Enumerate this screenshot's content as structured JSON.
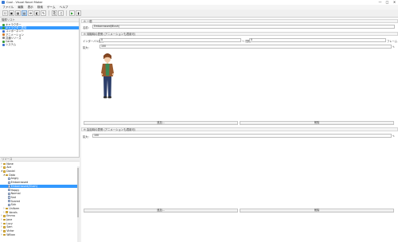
{
  "window": {
    "title": "Cool - Visual Novel Maker",
    "minimize": "—",
    "maximize": "□",
    "close": "✕"
  },
  "menu": [
    "ファイル",
    "編集",
    "表示",
    "検索",
    "ゲーム",
    "ヘルプ"
  ],
  "toolbar": {
    "icons": [
      "☐",
      "▣",
      "▦",
      "▤",
      "⛯",
      "◧",
      "✎",
      "⎘",
      "♫",
      "▶",
      "▮"
    ]
  },
  "left_panel": {
    "header": "階層リスト",
    "items": [
      {
        "label": "キャラクター",
        "color": "#3a9a3a"
      },
      {
        "label": "キャラクター表情",
        "color": "#3a9a3a",
        "selected": true
      },
      {
        "label": "コンポーネント",
        "color": "#3a6fd0"
      },
      {
        "label": "アニメーション",
        "color": "#d07a2a"
      },
      {
        "label": "共通リソース",
        "color": "#888888"
      },
      {
        "label": "Cards",
        "color": "#3a9a3a"
      },
      {
        "label": "システム",
        "color": "#3a6fd0"
      }
    ]
  },
  "lower_tree": {
    "header": "リソース",
    "rows": [
      {
        "label": "None",
        "level": 1,
        "type": "folder",
        "exp": "▷"
      },
      {
        "label": "Ace",
        "level": 1,
        "type": "folder",
        "exp": "▷"
      },
      {
        "label": "Daniel",
        "level": 1,
        "type": "folder",
        "exp": "◢"
      },
      {
        "label": "Data",
        "level": 2,
        "type": "folder",
        "exp": "◢"
      },
      {
        "label": "Angry",
        "level": 3,
        "type": "file"
      },
      {
        "label": "Embarrassed",
        "level": 3,
        "type": "file"
      },
      {
        "label": "Embarrassed(Blush)",
        "level": 3,
        "type": "file",
        "selected": true
      },
      {
        "label": "Happy",
        "level": 3,
        "type": "file"
      },
      {
        "label": "Normal",
        "level": 3,
        "type": "file"
      },
      {
        "label": "Sad",
        "level": 3,
        "type": "file"
      },
      {
        "label": "Scared",
        "level": 3,
        "type": "file"
      },
      {
        "label": "Sick",
        "level": 3,
        "type": "file"
      },
      {
        "label": "Uniform",
        "level": 2,
        "type": "folder",
        "exp": "▷"
      },
      {
        "label": "Vocals",
        "level": 2,
        "type": "folder",
        "exp": "▷"
      },
      {
        "label": "Emma",
        "level": 1,
        "type": "folder",
        "exp": "▷"
      },
      {
        "label": "Jane",
        "level": 1,
        "type": "folder",
        "exp": "▷"
      },
      {
        "label": "Lucy",
        "level": 1,
        "type": "folder",
        "exp": "▷"
      },
      {
        "label": "Sam",
        "level": 1,
        "type": "folder",
        "exp": "▷"
      },
      {
        "label": "Victor",
        "level": 1,
        "type": "folder",
        "exp": "▷"
      },
      {
        "label": "Willow",
        "level": 1,
        "type": "folder",
        "exp": "▷"
      }
    ]
  },
  "main": {
    "general_header": "一般",
    "name_label": "名前:",
    "name_value": "Embarrassed(Blush)",
    "section1": {
      "header": "待機時の表情 (アニメーションも適用可)",
      "interval_label": "インターバル間隔:",
      "interval_value": "0",
      "to_label": "〜 間隔:",
      "to_value": "0",
      "unit": "フレーム",
      "scale_label": "拡大:",
      "scale_value": "100",
      "add_button": "追加...",
      "delete_button": "削除"
    },
    "section2": {
      "header": "会話時の表情 (アニメーションも適用可)",
      "scale_label": "拡大:",
      "scale_value": "100",
      "add_button": "追加...",
      "delete_button": "削除"
    },
    "character_icon": "character-sprite"
  }
}
